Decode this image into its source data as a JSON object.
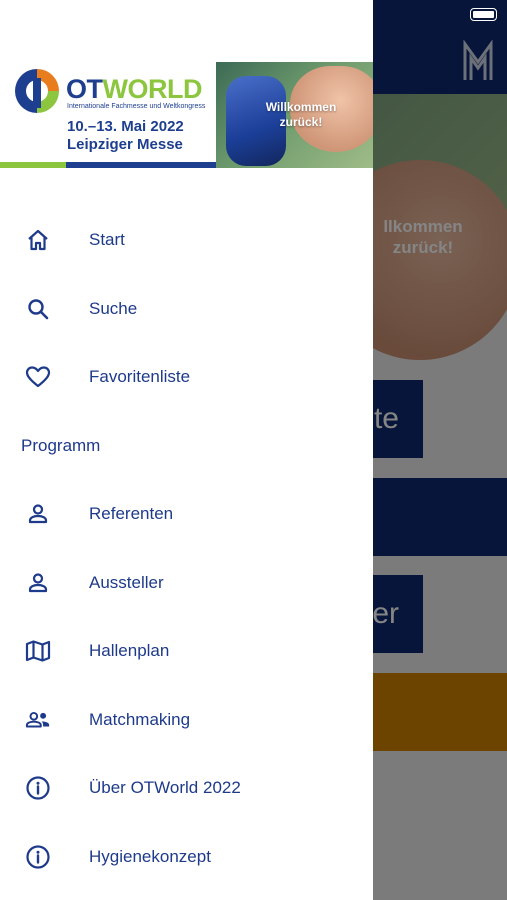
{
  "background": {
    "hero_text": "llkommen\nzurück!",
    "button1_partial": "te",
    "button3_partial": "er"
  },
  "banner": {
    "logo_name_ot": "OT",
    "logo_name_world": "WORLD",
    "subtitle": "Internationale Fachmesse und Weltkongress",
    "date": "10.–13. Mai 2022",
    "venue": "Leipziger Messe",
    "welcome": "Willkommen zurück!"
  },
  "menu": {
    "items": [
      {
        "label": "Start",
        "icon": "home-icon"
      },
      {
        "label": "Suche",
        "icon": "search-icon"
      },
      {
        "label": "Favoritenliste",
        "icon": "heart-icon"
      }
    ],
    "section_title": "Programm",
    "program_items": [
      {
        "label": "Referenten",
        "icon": "person-icon"
      },
      {
        "label": "Aussteller",
        "icon": "person-icon"
      },
      {
        "label": "Hallenplan",
        "icon": "map-icon"
      },
      {
        "label": "Matchmaking",
        "icon": "people-icon"
      },
      {
        "label": "Über OTWorld 2022",
        "icon": "info-icon"
      },
      {
        "label": "Hygienekonzept",
        "icon": "info-icon"
      }
    ]
  },
  "colors": {
    "brand_blue": "#1e3a8a",
    "header_navy": "#0c2a6e",
    "accent_orange": "#e87d1e",
    "accent_green": "#8cc63f",
    "highlight_orange": "#d08300"
  }
}
